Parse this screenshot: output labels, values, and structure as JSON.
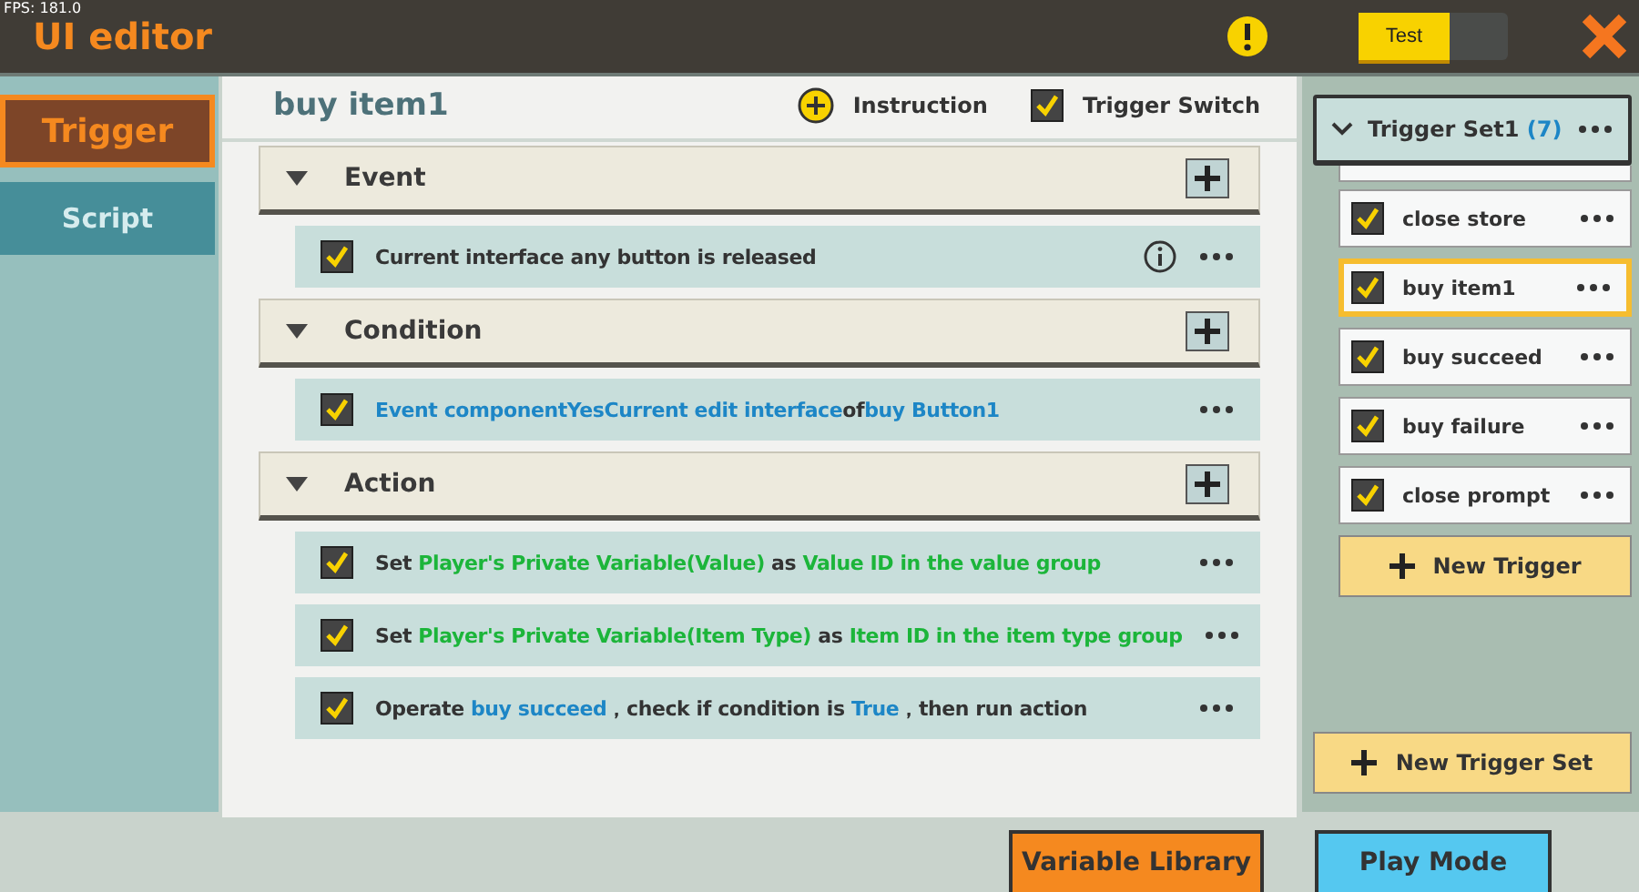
{
  "top_bar": {
    "fps": "FPS: 181.0",
    "title": "UI editor",
    "test_toggle": {
      "label": "Test",
      "on": true
    }
  },
  "sidebar": {
    "items": [
      {
        "label": "Trigger",
        "selected": true
      },
      {
        "label": "Script",
        "selected": false
      }
    ]
  },
  "editor": {
    "title": "buy item1",
    "instruction": "Instruction",
    "trigger_switch": {
      "label": "Trigger Switch",
      "checked": true
    },
    "sections": [
      {
        "title": "Event",
        "expanded": true,
        "rows": [
          {
            "checked": true,
            "info": true,
            "parts": [
              {
                "kind": "plain",
                "text": "Current interface any button is released"
              }
            ]
          }
        ]
      },
      {
        "title": "Condition",
        "expanded": true,
        "rows": [
          {
            "checked": true,
            "info": false,
            "parts": [
              {
                "kind": "value",
                "text": "Event componentYesCurrent edit interface"
              },
              {
                "kind": "plain",
                "text": "of"
              },
              {
                "kind": "value",
                "text": "buy Button1"
              }
            ]
          }
        ]
      },
      {
        "title": "Action",
        "expanded": true,
        "rows": [
          {
            "checked": true,
            "info": false,
            "parts": [
              {
                "kind": "plain",
                "text": "Set "
              },
              {
                "kind": "variable",
                "text": "Player's Private Variable(Value)"
              },
              {
                "kind": "plain",
                "text": " as "
              },
              {
                "kind": "variable",
                "text": "Value ID in the value group"
              }
            ]
          },
          {
            "checked": true,
            "info": false,
            "parts": [
              {
                "kind": "plain",
                "text": "Set "
              },
              {
                "kind": "variable",
                "text": "Player's Private Variable(Item Type)"
              },
              {
                "kind": "plain",
                "text": " as "
              },
              {
                "kind": "variable",
                "text": "Item ID in the item type group"
              }
            ]
          },
          {
            "checked": true,
            "info": false,
            "parts": [
              {
                "kind": "plain",
                "text": "Operate "
              },
              {
                "kind": "value",
                "text": "buy succeed"
              },
              {
                "kind": "plain",
                "text": "，check if condition is "
              },
              {
                "kind": "value",
                "text": "True"
              },
              {
                "kind": "plain",
                "text": "，then run action"
              }
            ]
          }
        ]
      }
    ]
  },
  "trigger_set": {
    "title": "Trigger Set1",
    "count": "(7)",
    "expanded": true,
    "items": [
      {
        "label": "close store",
        "checked": true,
        "selected": false
      },
      {
        "label": "buy item1",
        "checked": true,
        "selected": true
      },
      {
        "label": "buy succeed",
        "checked": true,
        "selected": false
      },
      {
        "label": "buy failure",
        "checked": true,
        "selected": false
      },
      {
        "label": "close prompt",
        "checked": true,
        "selected": false
      }
    ],
    "new_trigger": "New Trigger",
    "new_trigger_set": "New Trigger Set"
  },
  "bottom_bar": {
    "buttons": [
      {
        "label": "Variable Library",
        "kind": "library"
      },
      {
        "label": "Play Mode",
        "kind": "play"
      }
    ]
  }
}
